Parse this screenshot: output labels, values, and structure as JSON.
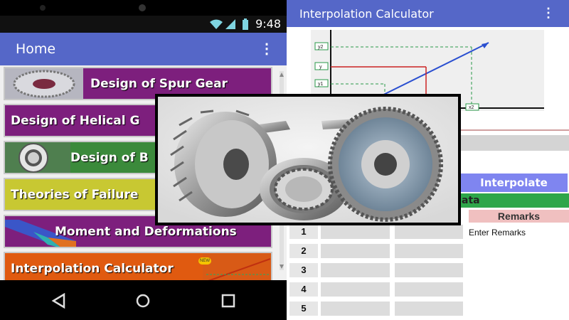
{
  "phone": {
    "status": {
      "time": "9:48"
    },
    "appbar": {
      "title": "Home"
    },
    "menu": [
      {
        "label": "Design of Spur Gear"
      },
      {
        "label": "Design of Helical G"
      },
      {
        "label": "Design of B"
      },
      {
        "label": "Theories of Failure"
      },
      {
        "label": "Moment and Deformations"
      },
      {
        "label": "Interpolation Calculator"
      }
    ],
    "badge": "NEW"
  },
  "calculator": {
    "title": "Interpolation Calculator",
    "graph": {
      "y2": "y2",
      "y": "y",
      "y1": "y1",
      "x2": "x2"
    },
    "interpolate_label": "Interpolate",
    "data_label": "ata",
    "remarks_header": "Remarks",
    "remarks_placeholder": "Enter Remarks",
    "rows": [
      "1",
      "2",
      "3",
      "4",
      "5"
    ]
  },
  "colors": {
    "appbar": "#5567c8",
    "menu_purple": "#7d1f7d",
    "menu_yellow": "#c8c832",
    "menu_green": "#2f8a2f",
    "menu_orange": "#e05a10",
    "interpolate": "#7f85f0",
    "data_green": "#2ea64a",
    "remarks_pink": "#f0c0c0"
  }
}
